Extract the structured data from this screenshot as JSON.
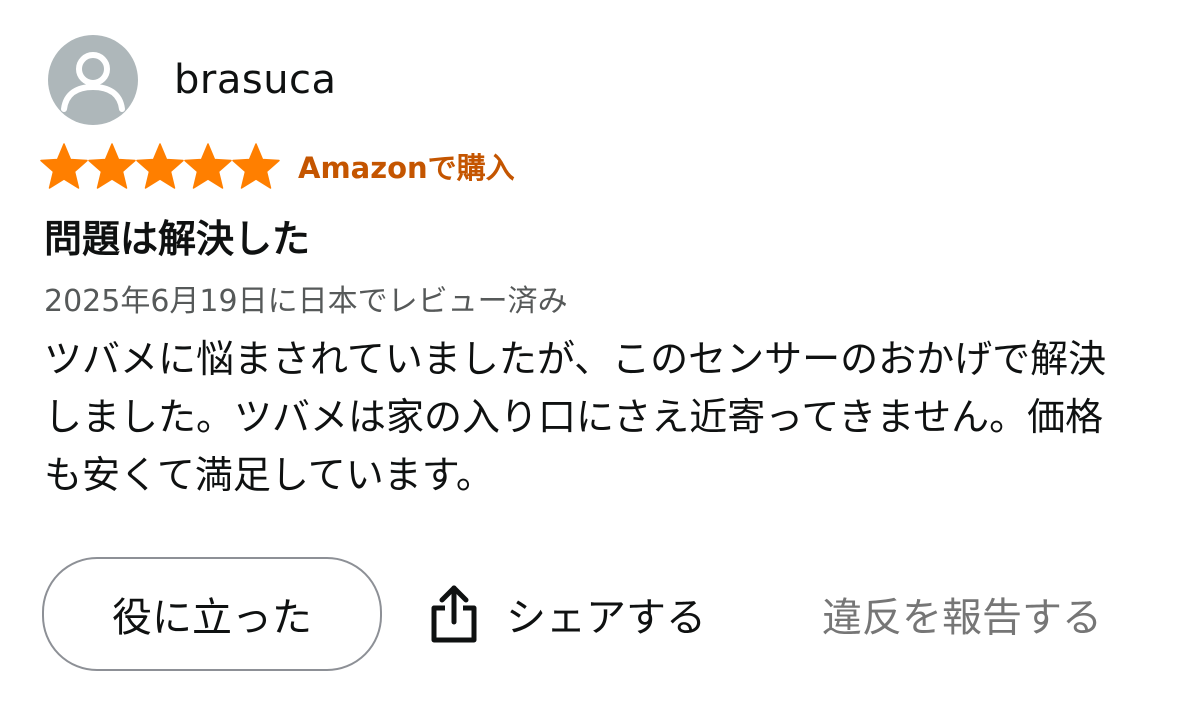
{
  "review": {
    "author": "brasuca",
    "avatar_icon": "user-silhouette-icon",
    "rating": 5,
    "rating_max": 5,
    "star_color": "#ff7f00",
    "verified_label": "Amazonで購入",
    "verified_color": "#c45500",
    "title": "問題は解決した",
    "date_line": "2025年6月19日に日本でレビュー済み",
    "body": "ツバメに悩まされていましたが、このセンサーのおかげで解決しました。ツバメは家の入り口にさえ近寄ってきません。価格も安くて満足しています。"
  },
  "actions": {
    "helpful_label": "役に立った",
    "share_label": "シェアする",
    "share_icon": "share-icon",
    "report_label": "違反を報告する"
  }
}
